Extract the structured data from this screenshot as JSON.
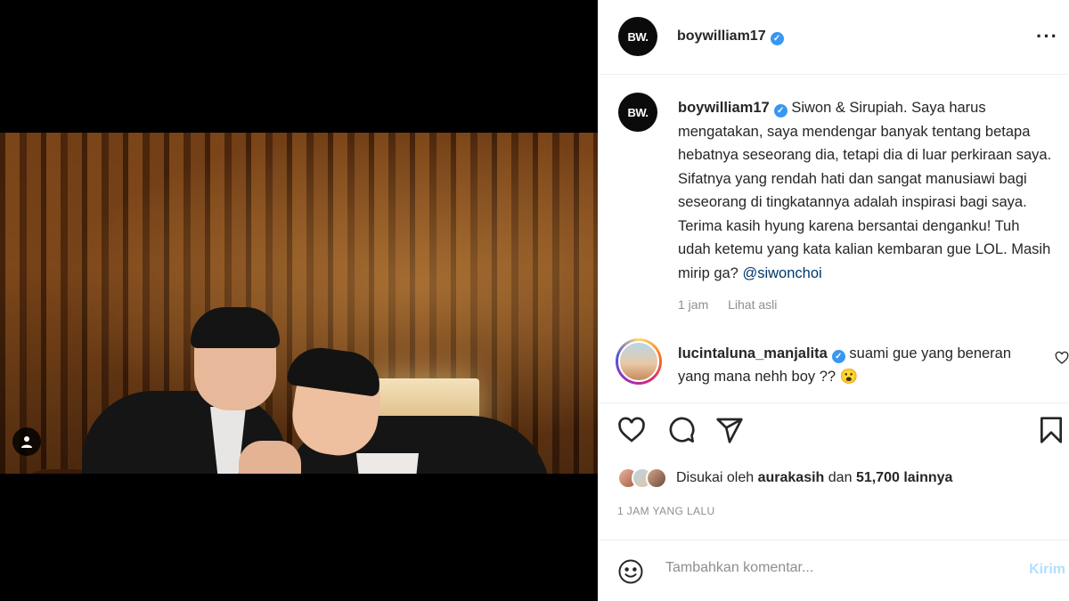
{
  "post": {
    "author": {
      "username": "boywilliam17",
      "avatar_initials": "BW.",
      "verified": true
    },
    "menu_icon": "more-horizontal-icon",
    "caption": {
      "username": "boywilliam17",
      "text": "Siwon & Sirupiah. Saya harus mengatakan, saya mendengar banyak tentang betapa hebatnya seseorang dia, tetapi dia di luar perkiraan saya. Sifatnya yang rendah hati dan sangat manusiawi bagi seseorang di tingkatannya adalah inspirasi bagi saya. Terima kasih hyung karena bersantai denganku! Tuh udah ketemu yang kata kalian kembaran gue LOL. Masih mirip ga?",
      "mention": "@siwonchoi",
      "time": "1 jam",
      "see_original": "Lihat asli"
    },
    "comments": [
      {
        "username": "lucintaluna_manjalita",
        "verified": true,
        "text": "suami gue yang beneran yang mana nehh boy ?? 😮"
      }
    ],
    "actions": {
      "like_icon": "heart-icon",
      "comment_icon": "comment-icon",
      "share_icon": "send-icon",
      "save_icon": "bookmark-icon"
    },
    "likes": {
      "prefix": "Disukai oleh",
      "liked_by": "aurakasih",
      "conjunction": "dan",
      "others": "51,700 lainnya"
    },
    "timestamp": "1 JAM YANG LALU",
    "add_comment": {
      "placeholder": "Tambahkan komentar...",
      "post_label": "Kirim"
    }
  },
  "colors": {
    "verified": "#3897f0",
    "link": "#00376b",
    "muted": "#8e8e8e",
    "post_button_disabled": "#b2dffc"
  }
}
